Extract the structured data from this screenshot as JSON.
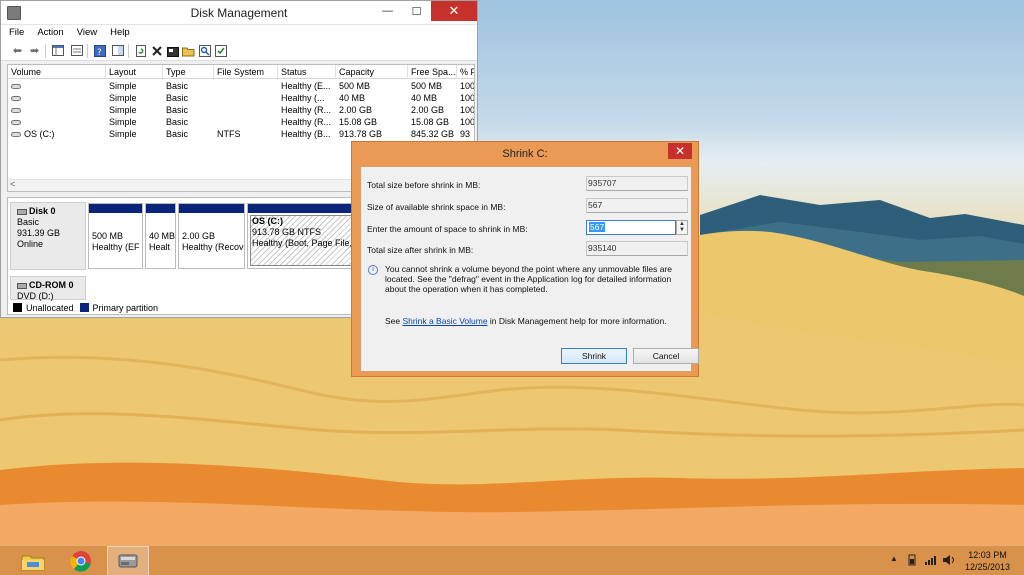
{
  "window": {
    "title": "Disk Management",
    "controls": {
      "minimize": "—",
      "maximize": "☐",
      "close": "✕"
    }
  },
  "menu": [
    "File",
    "Action",
    "View",
    "Help"
  ],
  "toolbar_icons": [
    "back-icon",
    "forward-icon",
    "console-tree-icon",
    "properties-icon",
    "help-icon",
    "show-pane-icon",
    "refresh-icon",
    "delete-icon",
    "properties2-icon",
    "open-icon",
    "explore-icon",
    "rescan-icon"
  ],
  "volume_list": {
    "columns": [
      "Volume",
      "Layout",
      "Type",
      "File System",
      "Status",
      "Capacity",
      "Free Spa...",
      "% F"
    ],
    "rows": [
      {
        "volume": "",
        "layout": "Simple",
        "type": "Basic",
        "fs": "",
        "status": "Healthy (E...",
        "capacity": "500 MB",
        "free": "500 MB",
        "pct": "100"
      },
      {
        "volume": "",
        "layout": "Simple",
        "type": "Basic",
        "fs": "",
        "status": "Healthy (...",
        "capacity": "40 MB",
        "free": "40 MB",
        "pct": "100"
      },
      {
        "volume": "",
        "layout": "Simple",
        "type": "Basic",
        "fs": "",
        "status": "Healthy (R...",
        "capacity": "2.00 GB",
        "free": "2.00 GB",
        "pct": "100"
      },
      {
        "volume": "",
        "layout": "Simple",
        "type": "Basic",
        "fs": "",
        "status": "Healthy (R...",
        "capacity": "15.08 GB",
        "free": "15.08 GB",
        "pct": "100"
      },
      {
        "volume": "OS (C:)",
        "layout": "Simple",
        "type": "Basic",
        "fs": "NTFS",
        "status": "Healthy (B...",
        "capacity": "913.78 GB",
        "free": "845.32 GB",
        "pct": "93"
      }
    ],
    "scroll_left": "<"
  },
  "disks": {
    "disk0": {
      "name": "Disk 0",
      "type": "Basic",
      "size": "931.39 GB",
      "state": "Online"
    },
    "partitions": [
      {
        "line1": "500 MB",
        "line2": "Healthy (EF"
      },
      {
        "line1": "40 MB",
        "line2": "Healt"
      },
      {
        "line1": "2.00 GB",
        "line2": "Healthy (Recov"
      },
      {
        "line1": "OS  (C:)",
        "line2": "913.78 GB NTFS",
        "line3": "Healthy (Boot, Page File,"
      }
    ],
    "cdrom": {
      "name": "CD-ROM 0",
      "label": "DVD (D:)"
    },
    "legend": [
      {
        "label": "Unallocated",
        "color": "#000000"
      },
      {
        "label": "Primary partition",
        "color": "#0a247a"
      }
    ]
  },
  "shrink_dialog": {
    "title": "Shrink C:",
    "close": "✕",
    "fields": [
      {
        "label": "Total size before shrink in MB:",
        "value": "935707"
      },
      {
        "label": "Size of available shrink space in MB:",
        "value": "567"
      },
      {
        "label": "Enter the amount of space to shrink in MB:",
        "value": "567"
      },
      {
        "label": "Total size after shrink in MB:",
        "value": "935140"
      }
    ],
    "info": "You cannot shrink a volume beyond the point where any unmovable files are located. See the \"defrag\" event in the Application log for detailed information about the operation when it has completed.",
    "see_prefix": "See",
    "see_link": "Shrink a Basic Volume",
    "see_suffix": "in Disk Management help for more information.",
    "shrink_button": "Shrink",
    "cancel_button": "Cancel"
  },
  "taskbar": {
    "apps": [
      "file-explorer-icon",
      "chrome-icon",
      "disk-management-icon"
    ],
    "tray_up": "▲",
    "time": "12:03 PM",
    "date": "12/25/2013"
  }
}
